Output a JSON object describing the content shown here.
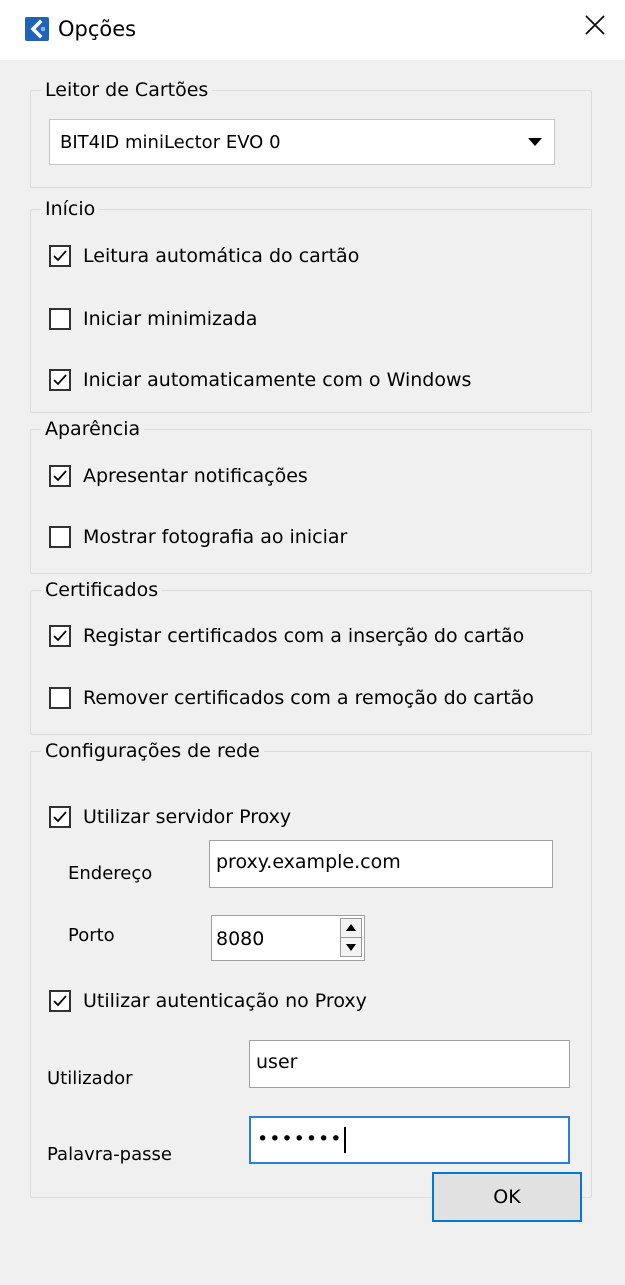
{
  "window": {
    "title": "Opções",
    "icon": "app-logo-icon",
    "close_icon": "close-icon"
  },
  "card_reader": {
    "legend": "Leitor de Cartões",
    "selected": "BIT4ID miniLector EVO 0"
  },
  "startup": {
    "legend": "Início",
    "options": [
      {
        "label": "Leitura automática do cartão",
        "checked": true
      },
      {
        "label": "Iniciar minimizada",
        "checked": false
      },
      {
        "label": "Iniciar automaticamente com o Windows",
        "checked": true
      }
    ]
  },
  "appearance": {
    "legend": "Aparência",
    "options": [
      {
        "label": "Apresentar notificações",
        "checked": true
      },
      {
        "label": "Mostrar fotografia ao iniciar",
        "checked": false
      }
    ]
  },
  "certificates": {
    "legend": "Certificados",
    "options": [
      {
        "label": "Registar certificados com a inserção do cartão",
        "checked": true
      },
      {
        "label": "Remover certificados com a remoção do cartão",
        "checked": false
      }
    ]
  },
  "network": {
    "legend": "Configurações de rede",
    "use_proxy": {
      "label": "Utilizar servidor Proxy",
      "checked": true
    },
    "address_label": "Endereço",
    "address_value": "proxy.example.com",
    "port_label": "Porto",
    "port_value": "8080",
    "use_auth": {
      "label": "Utilizar autenticação no Proxy",
      "checked": true
    },
    "user_label": "Utilizador",
    "user_value": "user",
    "password_label": "Palavra-passe",
    "password_value": "•••••••"
  },
  "buttons": {
    "ok_label": "OK"
  },
  "colors": {
    "accent": "#0078d7",
    "focus_border": "#2b7fd8",
    "dialog_background": "#f0f0f0",
    "app_icon": "#1f63b7"
  }
}
